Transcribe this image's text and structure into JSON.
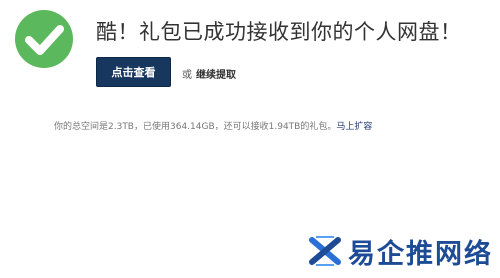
{
  "headline": "酷！礼包已成功接收到你的个人网盘！",
  "actions": {
    "view_label": "点击查看",
    "or_label": "或",
    "continue_label": "继续提取"
  },
  "space": {
    "text": "你的总空间是2.3TB，已使用364.14GB，还可以接收1.94TB的礼包。",
    "expand_label": "马上扩容"
  },
  "watermark": {
    "text": "易企推网络"
  },
  "colors": {
    "success": "#5cb85c",
    "button_bg": "#17375e",
    "link": "#1e3a6e",
    "watermark": "#1e4b96"
  }
}
